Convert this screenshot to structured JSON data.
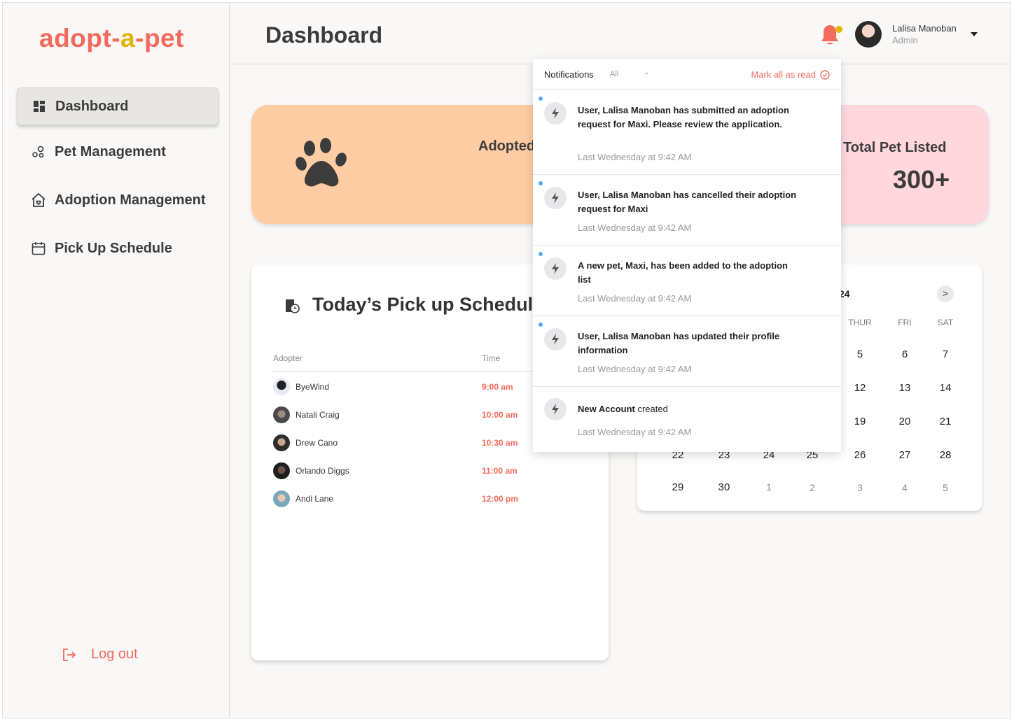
{
  "brand": {
    "part1": "ado",
    "part1b": "pt",
    "sep1": "-",
    "part2": "a",
    "sep2": "-",
    "part3": "pet"
  },
  "sidebar": {
    "items": [
      {
        "label": "Dashboard",
        "icon": "dashboard-icon",
        "active": true
      },
      {
        "label": "Pet Management",
        "icon": "pets-icon"
      },
      {
        "label": "Adoption Management",
        "icon": "home-heart-icon"
      },
      {
        "label": "Pick Up Schedule",
        "icon": "calendar-icon"
      }
    ],
    "logout_label": "Log out"
  },
  "header": {
    "title": "Dashboard",
    "user_name": "Lalisa Manoban",
    "user_role": "Admin"
  },
  "stats": {
    "adopted_label": "Adopted",
    "total_label": "Total Pet Listed",
    "total_value": "300+"
  },
  "pickup": {
    "title": "Today’s Pick up Schedule",
    "col_adopter": "Adopter",
    "col_time": "Time",
    "rows": [
      {
        "name": "ByeWind",
        "time": "9:00 am"
      },
      {
        "name": "Natali Craig",
        "time": "10:00 am"
      },
      {
        "name": "Drew Cano",
        "time": "10:30 am"
      },
      {
        "name": "Orlando Diggs",
        "time": "11:00 am"
      },
      {
        "name": "Andi Lane",
        "time": "12:00 pm"
      }
    ]
  },
  "calendar": {
    "header_fragment": "24",
    "next_label": ">",
    "weekdays": [
      "THUR",
      "FRI",
      "SAT"
    ],
    "days": {
      "row1": [
        "5",
        "6",
        "7"
      ],
      "row2": [
        "12",
        "13",
        "14"
      ],
      "row3": [
        "19",
        "20",
        "21"
      ],
      "row4": [
        "22",
        "23",
        "24",
        "25",
        "26",
        "27",
        "28"
      ],
      "row5": [
        "29",
        "30",
        "1",
        "2",
        "3",
        "4",
        "5"
      ]
    }
  },
  "notifications": {
    "title": "Notifications",
    "filter": "All",
    "mark_all": "Mark all as read",
    "items": [
      {
        "bold": "User, Lalisa Manoban has submitted an adoption request for Maxi. Please review the application.",
        "light": "",
        "time": "Last Wednesday at 9:42 AM",
        "unread": true
      },
      {
        "bold": "User, Lalisa Manoban has cancelled their adoption request for Maxi",
        "light": "",
        "time": "Last Wednesday at 9:42 AM",
        "unread": true
      },
      {
        "bold": "A new pet, Maxi, has been added to the adoption list",
        "light": "",
        "time": "Last Wednesday at 9:42 AM",
        "unread": true
      },
      {
        "bold": "User, Lalisa Manoban  has updated their profile information",
        "light": "",
        "time": "Last Wednesday at 9:42 AM",
        "unread": true
      },
      {
        "bold": "New Account",
        "light": " created",
        "time": "Last Wednesday at 9:42 AM",
        "unread": false
      }
    ]
  },
  "colors": {
    "accent": "#f36b5c",
    "brand_yellow": "#e0b400",
    "orange_card": "#fecca2",
    "pink_card": "#ffd7dc",
    "unread_dot": "#55a8f2"
  }
}
